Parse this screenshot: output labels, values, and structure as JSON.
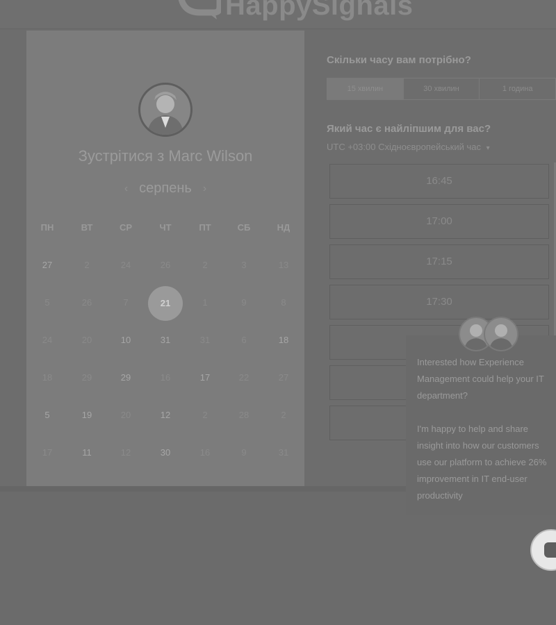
{
  "header": {
    "logo_text": "HappySignals"
  },
  "scheduler": {
    "title": "Зустрітися з Marc Wilson",
    "month": "серпень",
    "prev_arrow": "‹",
    "next_arrow": "›",
    "weekdays": [
      "ПН",
      "ВТ",
      "СР",
      "ЧТ",
      "ПТ",
      "СБ",
      "НД"
    ],
    "days": [
      [
        "27",
        "2",
        "24",
        "26",
        "2",
        "3",
        "13"
      ],
      [
        "5",
        "26",
        "7",
        "21",
        "1",
        "9",
        "8"
      ],
      [
        "24",
        "20",
        "10",
        "31",
        "31",
        "6",
        "18"
      ],
      [
        "18",
        "29",
        "29",
        "16",
        "17",
        "22",
        "27"
      ],
      [
        "5",
        "19",
        "20",
        "12",
        "2",
        "28",
        "2"
      ],
      [
        "17",
        "11",
        "12",
        "30",
        "16",
        "9",
        "31"
      ]
    ],
    "selected_day": "21"
  },
  "duration": {
    "question": "Скільки часу вам потрібно?",
    "options": [
      "15 хвилин",
      "30 хвилин",
      "1 година"
    ]
  },
  "time": {
    "question": "Який час є найліпшим для вас?",
    "timezone": "UTC +03:00 Східноєвропейський час",
    "timezone_caret": "▾",
    "slots": [
      "16:45",
      "17:00",
      "17:15",
      "17:30",
      "",
      "",
      ""
    ]
  },
  "chat": {
    "message_1": "Interested how Experience Management could help your IT department?",
    "message_2": "I'm happy to help and share insight into how our customers use our platform to achieve 26% improvement in IT end-user productivity"
  }
}
